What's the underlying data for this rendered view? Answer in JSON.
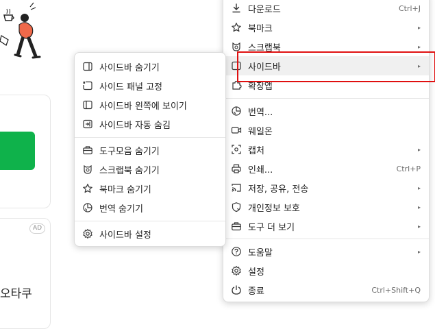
{
  "background": {
    "ad_label": "AD",
    "bottom_text": "오타쿠"
  },
  "main_menu": {
    "items": [
      {
        "label": "다운로드",
        "icon": "download-icon",
        "shortcut": "Ctrl+J"
      },
      {
        "label": "북마크",
        "icon": "star-icon",
        "submenu": true
      },
      {
        "label": "스크랩북",
        "icon": "scrapbook-icon",
        "submenu": true
      },
      {
        "label": "사이드바",
        "icon": "sidebar-icon",
        "submenu": true,
        "highlighted": true
      },
      {
        "label": "확장앱",
        "icon": "puzzle-icon"
      },
      {
        "label": "번역...",
        "icon": "translate-icon"
      },
      {
        "label": "웨일온",
        "icon": "video-icon"
      },
      {
        "label": "캡처",
        "icon": "capture-icon",
        "submenu": true
      },
      {
        "label": "인쇄...",
        "icon": "printer-icon",
        "shortcut": "Ctrl+P"
      },
      {
        "label": "저장, 공유, 전송",
        "icon": "cast-icon",
        "submenu": true
      },
      {
        "label": "개인정보 보호",
        "icon": "shield-icon",
        "submenu": true
      },
      {
        "label": "도구 더 보기",
        "icon": "toolbox-icon",
        "submenu": true
      },
      {
        "label": "도움말",
        "icon": "help-icon",
        "submenu": true
      },
      {
        "label": "설정",
        "icon": "gear-icon"
      },
      {
        "label": "종료",
        "icon": "power-icon",
        "shortcut": "Ctrl+Shift+Q"
      }
    ]
  },
  "sidebar_submenu": {
    "items": [
      {
        "label": "사이드바 숨기기",
        "icon": "sidebar-panel-icon"
      },
      {
        "label": "사이드 패널 고정",
        "icon": "pin-panel-icon"
      },
      {
        "label": "사이드바 왼쪽에 보이기",
        "icon": "sidebar-left-icon"
      },
      {
        "label": "사이드바 자동 숨김",
        "icon": "auto-hide-icon"
      },
      {
        "label": "도구모음 숨기기",
        "icon": "toolbox-icon"
      },
      {
        "label": "스크랩북 숨기기",
        "icon": "scrapbook-icon"
      },
      {
        "label": "북마크 숨기기",
        "icon": "star-icon"
      },
      {
        "label": "번역 숨기기",
        "icon": "translate-icon"
      },
      {
        "label": "사이드바 설정",
        "icon": "gear-icon"
      }
    ]
  },
  "colors": {
    "highlight_box": "#e01010",
    "green_button": "#0fb24b",
    "menu_hover": "#f0f0f0"
  }
}
